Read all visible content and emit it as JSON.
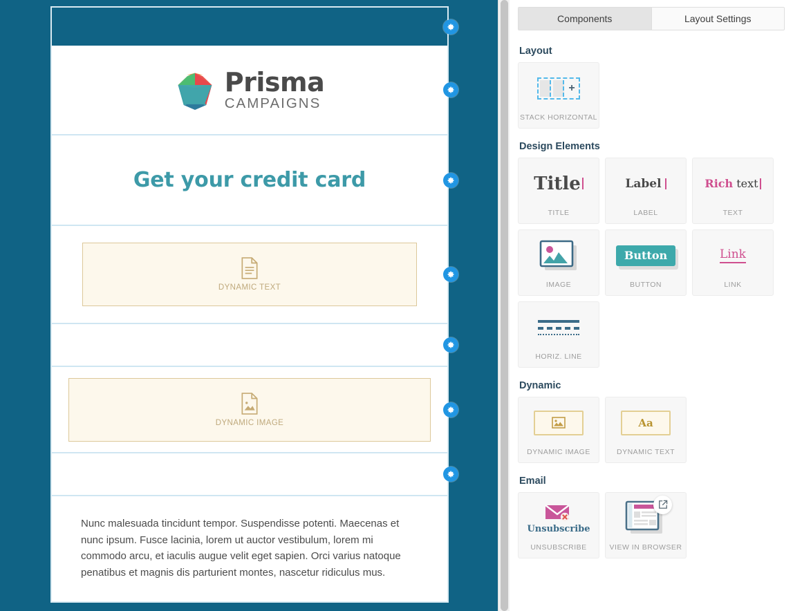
{
  "email_canvas": {
    "logo": {
      "word": "Prisma",
      "subtitle": "CAMPAIGNS"
    },
    "title": "Get your credit card",
    "dynamic_text_placeholder": "DYNAMIC TEXT",
    "dynamic_image_placeholder": "DYNAMIC IMAGE",
    "body_text": "Nunc malesuada tincidunt tempor. Suspendisse potenti. Maecenas et nunc ipsum. Fusce lacinia, lorem ut auctor vestibulum, lorem mi commodo arcu, et iaculis augue velit eget sapien. Orci varius natoque penatibus et magnis dis parturient montes, nascetur ridiculus mus.",
    "row_settings_icon": "gear-icon",
    "colors": {
      "canvas_background": "#106385",
      "header_band": "#106385",
      "row_divider": "#cfe6f2",
      "title_text": "#3d9aa8",
      "dynamic_fill": "#fdf8ec",
      "dynamic_border": "#dcc89a",
      "gear_badge": "#2196e3"
    }
  },
  "panel": {
    "tabs": [
      {
        "label": "Components",
        "active": true
      },
      {
        "label": "Layout Settings",
        "active": false
      }
    ],
    "groups": [
      {
        "title": "Layout",
        "tiles": [
          {
            "label": "STACK HORIZONTAL",
            "icon": "stack-horizontal-icon"
          }
        ]
      },
      {
        "title": "Design Elements",
        "tiles": [
          {
            "label": "TITLE",
            "icon": "title-icon",
            "art_text": "Title"
          },
          {
            "label": "LABEL",
            "icon": "label-icon",
            "art_text": "Label"
          },
          {
            "label": "TEXT",
            "icon": "rich-text-icon",
            "art_text_bold": "Rich",
            "art_text_rest": " text"
          },
          {
            "label": "IMAGE",
            "icon": "image-icon"
          },
          {
            "label": "BUTTON",
            "icon": "button-icon",
            "art_text": "Button"
          },
          {
            "label": "LINK",
            "icon": "link-icon",
            "art_text": "Link"
          },
          {
            "label": "HORIZ. LINE",
            "icon": "horizontal-line-icon"
          }
        ]
      },
      {
        "title": "Dynamic",
        "tiles": [
          {
            "label": "DYNAMIC IMAGE",
            "icon": "dynamic-image-icon"
          },
          {
            "label": "DYNAMIC TEXT",
            "icon": "dynamic-text-icon",
            "art_text": "Aa"
          }
        ]
      },
      {
        "title": "Email",
        "tiles": [
          {
            "label": "UNSUBSCRIBE",
            "icon": "unsubscribe-icon",
            "art_text": "Unsubscribe"
          },
          {
            "label": "VIEW IN BROWSER",
            "icon": "view-in-browser-icon"
          }
        ]
      }
    ],
    "colors": {
      "tab_active_bg": "#e4e4e4",
      "tile_bg": "#f7f7f7",
      "group_title": "#2c4a5e",
      "accent_blue": "#53b9ea",
      "accent_pink": "#cf4f8f",
      "accent_teal": "#3da9ab",
      "accent_gold": "#b8932f"
    }
  }
}
